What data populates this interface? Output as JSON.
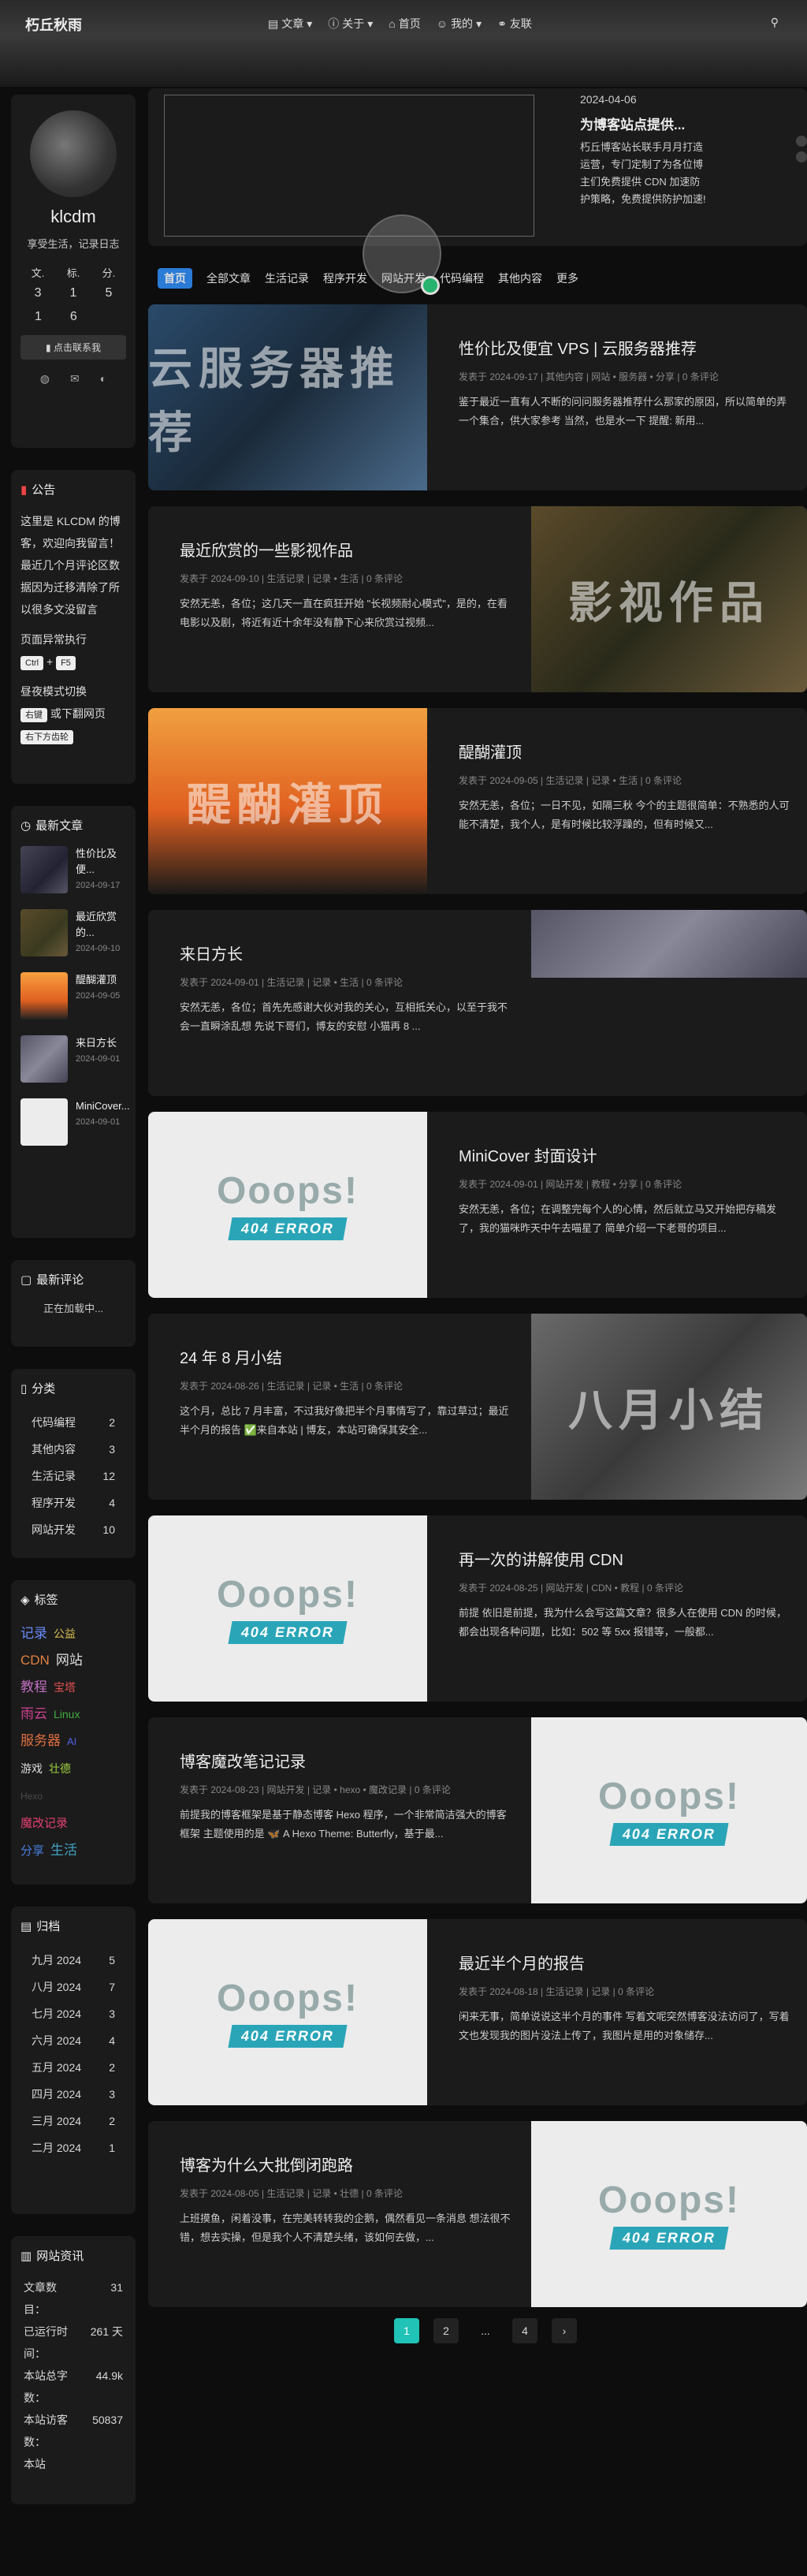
{
  "nav": {
    "brand": "朽丘秋雨",
    "menu": [
      "文章",
      "关于",
      "首页",
      "我的",
      "友联"
    ]
  },
  "profile": {
    "name": "klcdm",
    "desc": "享受生活，记录日志",
    "stats_labels": [
      "文.",
      "标.",
      "分."
    ],
    "stats_values": [
      "3",
      "1",
      "5"
    ],
    "extra_values": [
      "1",
      "6"
    ],
    "contact": "点击联系我"
  },
  "announcement": {
    "title": "公告",
    "text": "这里是 KLCDM 的博客，欢迎向我留言！最近几个月评论区数据因为迁移清除了所以很多文没留言",
    "line2": "页面异常执行",
    "key1": "Ctrl",
    "key2": "F5",
    "line3": "昼夜模式切换",
    "key3": "右键",
    "line3b": "或下翻网页",
    "key4": "右下方齿轮"
  },
  "recent_posts": {
    "title": "最新文章",
    "items": [
      {
        "title": "性价比及便...",
        "date": "2024-09-17"
      },
      {
        "title": "最近欣赏的...",
        "date": "2024-09-10"
      },
      {
        "title": "醍醐灌顶",
        "date": "2024-09-05"
      },
      {
        "title": "来日方长",
        "date": "2024-09-01"
      },
      {
        "title": "MiniCover...",
        "date": "2024-09-01"
      }
    ]
  },
  "recent_comments": {
    "title": "最新评论",
    "loading": "正在加载中..."
  },
  "categories": {
    "title": "分类",
    "items": [
      {
        "name": "代码编程",
        "count": "2"
      },
      {
        "name": "其他内容",
        "count": "3"
      },
      {
        "name": "生活记录",
        "count": "12"
      },
      {
        "name": "程序开发",
        "count": "4"
      },
      {
        "name": "网站开发",
        "count": "10"
      }
    ]
  },
  "tags": {
    "title": "标签",
    "items": [
      "记录",
      "公益",
      "CDN",
      "网站",
      "教程",
      "宝塔",
      "雨云",
      "Linux",
      "服务器",
      "AI",
      "游戏",
      "壮德",
      "Hexo",
      "魔改记录",
      "分享",
      "生活"
    ]
  },
  "archives": {
    "title": "归档",
    "items": [
      {
        "month": "九月 2024",
        "count": "5"
      },
      {
        "month": "八月 2024",
        "count": "7"
      },
      {
        "month": "七月 2024",
        "count": "3"
      },
      {
        "month": "六月 2024",
        "count": "4"
      },
      {
        "month": "五月 2024",
        "count": "2"
      },
      {
        "month": "四月 2024",
        "count": "3"
      },
      {
        "month": "三月 2024",
        "count": "2"
      },
      {
        "month": "二月 2024",
        "count": "1"
      }
    ]
  },
  "site_info": {
    "title": "网站资讯",
    "items": [
      {
        "k": "文章数目：",
        "v": "31"
      },
      {
        "k": "已运行时间：",
        "v": "261 天"
      },
      {
        "k": "本站总字数：",
        "v": "44.9k"
      },
      {
        "k": "本站访客数：",
        "v": "50837"
      },
      {
        "k": "本站",
        "v": ""
      }
    ]
  },
  "top": {
    "date": "2024-04-06",
    "title": "为博客站点提供...",
    "desc": "朽丘博客站长联手月月打造运营，专门定制了为各位博主们免费提供 CDN 加速防护策略，免费提供防护加速!"
  },
  "cats_bar": [
    "首页",
    "全部文章",
    "生活记录",
    "程序开发",
    "网站开发",
    "代码编程",
    "其他内容",
    "更多"
  ],
  "posts": [
    {
      "title": "性价比及便宜 VPS | 云服务器推荐",
      "meta": "发表于 2024-09-17 | 其他内容 | 网站 • 服务器 • 分享 | 0 条评论",
      "excerpt": "鉴于最近一直有人不断的问问服务器推荐什么那家的原因，所以简单的弄一个集合，供大家参考 当然，也是水一下 提醒: 新用...",
      "img": "云服务器推荐"
    },
    {
      "title": "最近欣赏的一些影视作品",
      "meta": "发表于 2024-09-10 | 生活记录 | 记录 • 生活 | 0 条评论",
      "excerpt": "安然无恙，各位；这几天一直在疯狂开始 \"长视频耐心模式\"，是的，在看电影以及剧，将近有近十余年没有静下心来欣赏过视频...",
      "img": "影视作品"
    },
    {
      "title": "醍醐灌顶",
      "meta": "发表于 2024-09-05 | 生活记录 | 记录 • 生活 | 0 条评论",
      "excerpt": "安然无恙，各位；一日不见，如隔三秋 今个的主题很简单：不熟悉的人可能不清楚，我个人，是有时候比较浮躁的，但有时候又...",
      "img": "醍醐灌顶"
    },
    {
      "title": "来日方长",
      "meta": "发表于 2024-09-01 | 生活记录 | 记录 • 生活 | 0 条评论",
      "excerpt": "安然无恙，各位；首先先感谢大伙对我的关心，互相抵关心，以至于我不会一直瞬涂乱想 先说下哥们，博友的安慰 小猫再 8 ...",
      "img": ""
    },
    {
      "title": "MiniCover 封面设计",
      "meta": "发表于 2024-09-01 | 网站开发 | 教程 • 分享 | 0 条评论",
      "excerpt": "安然无恙，各位；在调整完每个人的心情，然后就立马又开始把存稿发了，我的猫咪昨天中午去喵星了 简单介绍一下老哥的项目...",
      "img": "oops"
    },
    {
      "title": "24 年 8 月小结",
      "meta": "发表于 2024-08-26 | 生活记录 | 记录 • 生活 | 0 条评论",
      "excerpt": "这个月，总比 7 月丰富，不过我好像把半个月事情写了，靠过草过；最近半个月的报告 ✅来自本站 | 博友，本站可确保其安全...",
      "img": "八月小结"
    },
    {
      "title": "再一次的讲解使用 CDN",
      "meta": "发表于 2024-08-25 | 网站开发 | CDN • 教程 | 0 条评论",
      "excerpt": "前提 依旧是前提，我为什么会写这篇文章？很多人在使用 CDN 的时候，都会出现各种问题，比如：502 等 5xx 报错等，一般都...",
      "img": "oops"
    },
    {
      "title": "博客魔改笔记记录",
      "meta": "发表于 2024-08-23 | 网站开发 | 记录 • hexo • 魔改记录 | 0 条评论",
      "excerpt": "前提我的博客框架是基于静态博客 Hexo 程序，一个非常简洁强大的博客框架 主题使用的是 🦋 A Hexo Theme: Butterfly，基于最...",
      "img": "oops"
    },
    {
      "title": "最近半个月的报告",
      "meta": "发表于 2024-08-18 | 生活记录 | 记录 | 0 条评论",
      "excerpt": "闲来无事，简单说说这半个月的事件 写着文呢突然博客没法访问了，写着文也发现我的图片没法上传了，我图片是用的对象储存...",
      "img": "oops"
    },
    {
      "title": "博客为什么大批倒闭跑路",
      "meta": "发表于 2024-08-05 | 生活记录 | 记录 • 壮德 | 0 条评论",
      "excerpt": "上班摸鱼，闲着没事，在完美转转我的企鹅，偶然看见一条消息 想法很不错，想去实操，但是我个人不清楚头绪，该如何去做，...",
      "img": "oops"
    }
  ],
  "pager": [
    "1",
    "2",
    "...",
    "4",
    "›"
  ],
  "oops_text": "Ooops!",
  "oops_badge": "404 ERROR"
}
